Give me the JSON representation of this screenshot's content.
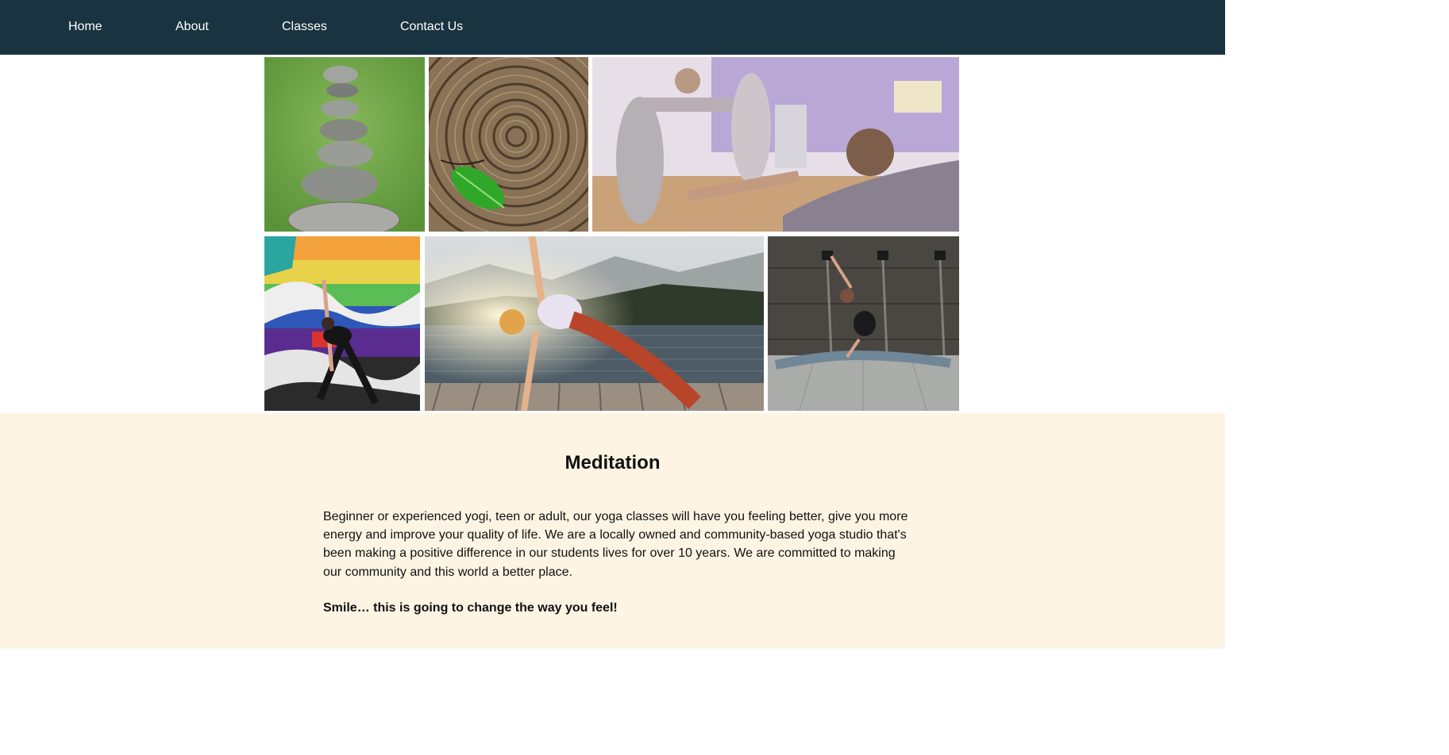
{
  "nav": {
    "items": [
      {
        "label": "Home"
      },
      {
        "label": "About"
      },
      {
        "label": "Classes"
      },
      {
        "label": "Contact Us"
      }
    ]
  },
  "gallery": {
    "images": [
      {
        "name": "stacked-stones-photo"
      },
      {
        "name": "tree-rings-leaf-photo"
      },
      {
        "name": "class-stretching-photo"
      },
      {
        "name": "mural-triangle-pose-photo"
      },
      {
        "name": "lake-side-plank-photo"
      },
      {
        "name": "splits-pose-photo"
      }
    ]
  },
  "section": {
    "heading": "Meditation",
    "paragraph": "Beginner or experienced yogi, teen or adult, our yoga classes will have you feeling better, give you more energy and improve your quality of life. We are a locally owned and community-based yoga studio that's been making a positive difference in our students lives for over 10 years. We are committed to making our community and this world a better place.",
    "tagline": "Smile… this is going to change the way you feel!"
  },
  "colors": {
    "nav_background": "#1a3340",
    "section_background": "#fdf4e3"
  }
}
